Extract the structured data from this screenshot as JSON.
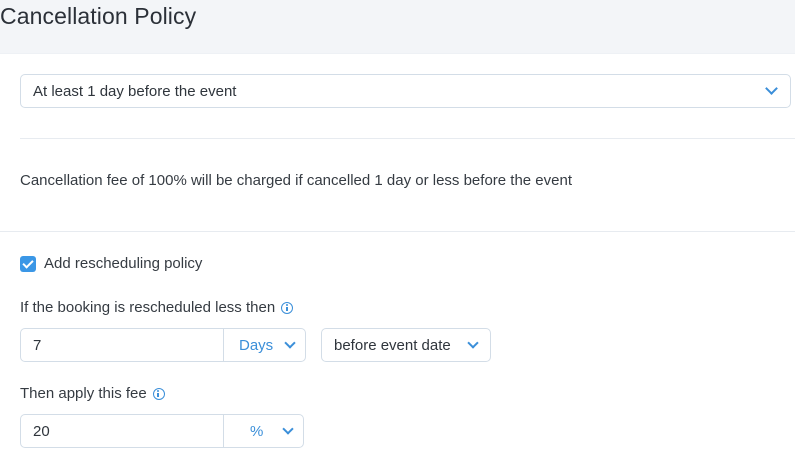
{
  "page": {
    "title": "Cancellation Policy"
  },
  "cancellation": {
    "selected_option": "At least 1 day before the event",
    "fee_description": "Cancellation fee of 100% will be charged if cancelled 1 day or less before the event"
  },
  "rescheduling": {
    "checkbox_label": "Add rescheduling policy",
    "checked": true,
    "threshold_label": "If the booking is rescheduled less then",
    "threshold_value": "7",
    "threshold_unit": "Days",
    "threshold_reference": "before event date",
    "fee_label": "Then apply this fee",
    "fee_value": "20",
    "fee_unit": "%"
  },
  "colors": {
    "accent": "#3b8fd9",
    "checkbox": "#3b97e6",
    "border": "#d3dde7"
  },
  "icons": [
    "chevron-down-icon",
    "info-icon",
    "checkbox-checked-icon"
  ]
}
